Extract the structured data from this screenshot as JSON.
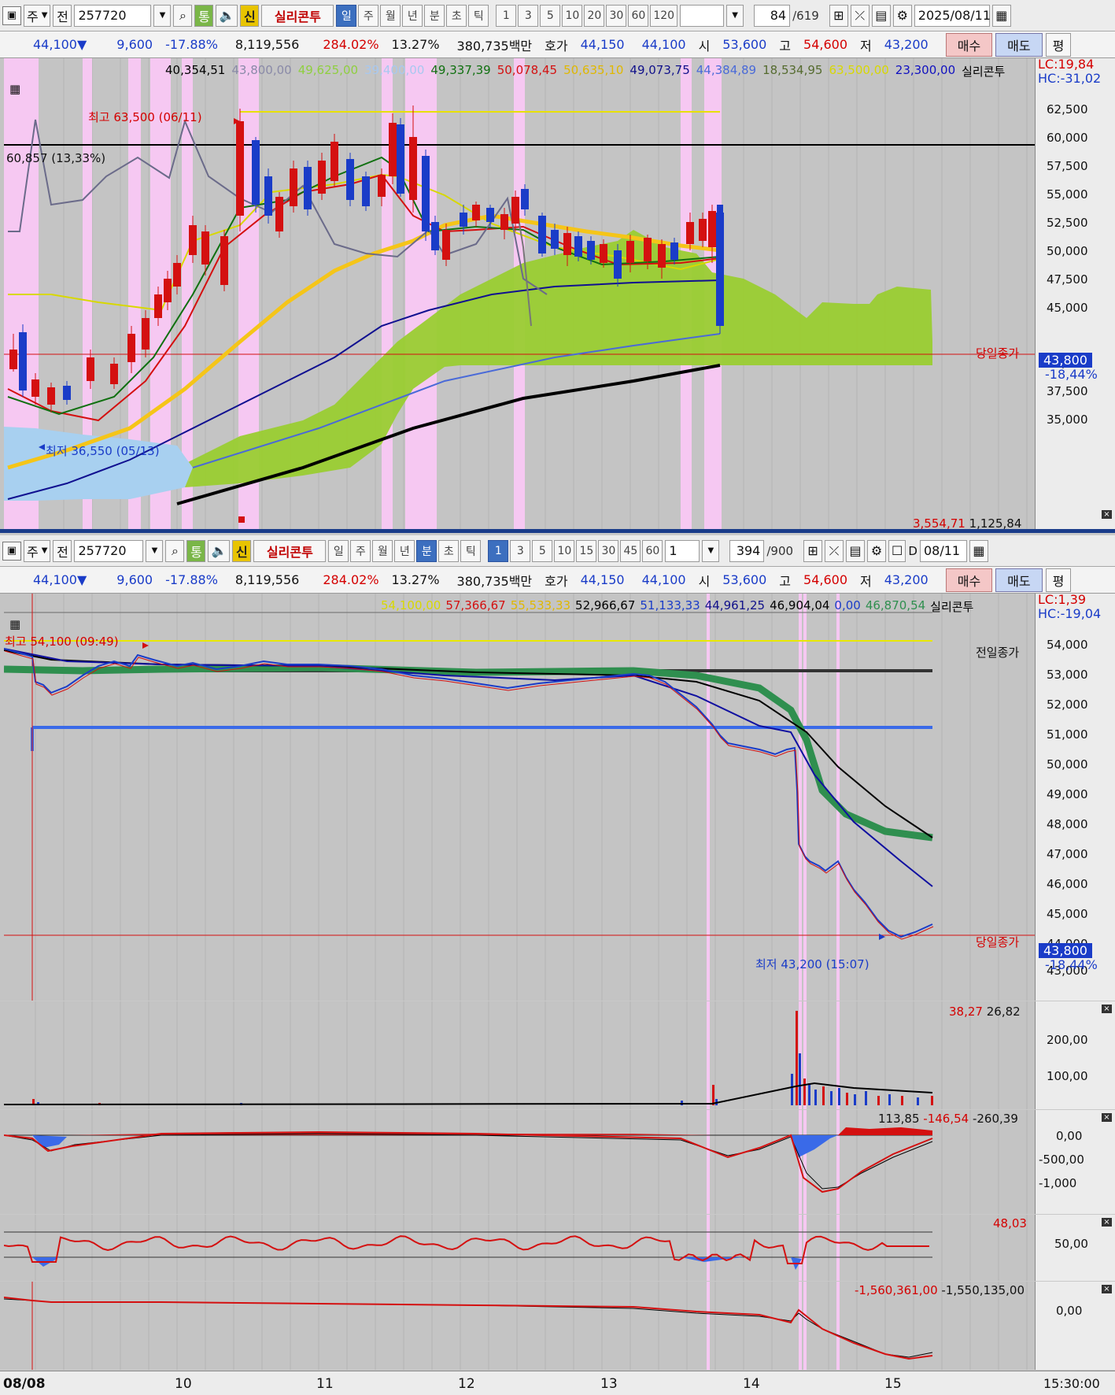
{
  "top_toolbar": {
    "type_btn": "주",
    "prev_btn": "전",
    "code": "257720",
    "tong": "통",
    "shin": "신",
    "name": "실리콘투",
    "periods": [
      "일",
      "주",
      "월",
      "년",
      "분",
      "초",
      "틱"
    ],
    "active_period": "일",
    "intervals": [
      "1",
      "3",
      "5",
      "10",
      "20",
      "30",
      "60",
      "120"
    ],
    "count": "84",
    "total": "/619",
    "date": "2025/08/11"
  },
  "bottom_toolbar": {
    "type_btn": "주",
    "prev_btn": "전",
    "code": "257720",
    "tong": "통",
    "shin": "신",
    "name": "실리콘투",
    "periods": [
      "일",
      "주",
      "월",
      "년",
      "분",
      "초",
      "틱"
    ],
    "active_period": "분",
    "intervals": [
      "1",
      "3",
      "5",
      "10",
      "15",
      "30",
      "45",
      "60"
    ],
    "active_interval": "1",
    "step": "1",
    "count": "394",
    "total": "/900",
    "d_label": "D",
    "date": "08/11"
  },
  "price_bar": {
    "price": "44,100▼",
    "change": "9,600",
    "rate": "-17.88%",
    "volume": "8,119,556",
    "vol_ratio": "284.02%",
    "turnover": "13.27%",
    "amount": "380,735백만",
    "hoga_label": "호가",
    "ask": "44,150",
    "bid": "44,100",
    "open_label": "시",
    "open": "53,600",
    "high_label": "고",
    "high": "54,600",
    "low_label": "저",
    "low": "43,200",
    "buy": "매수",
    "sell": "매도",
    "avg": "평"
  },
  "daily_chart": {
    "legend": [
      {
        "t": "40,354,51",
        "c": "#000000"
      },
      {
        "t": "43,800,00",
        "c": "#8a8aa8"
      },
      {
        "t": "49,625,00",
        "c": "#8fcf3f"
      },
      {
        "t": "39,400,00",
        "c": "#a8c8f0"
      },
      {
        "t": "49,337,39",
        "c": "#107010"
      },
      {
        "t": "50,078,45",
        "c": "#d41010"
      },
      {
        "t": "50,635,10",
        "c": "#e0b800"
      },
      {
        "t": "49,073,75",
        "c": "#10108a"
      },
      {
        "t": "44,384,89",
        "c": "#4a6ad8"
      },
      {
        "t": "18,534,95",
        "c": "#556b2f"
      },
      {
        "t": "63,500,00",
        "c": "#d8d800"
      },
      {
        "t": "23,300,00",
        "c": "#1010c0"
      },
      {
        "t": "실리콘투",
        "c": "#000000"
      }
    ],
    "lc": "LC:19,84",
    "hc": "HC:-31,02",
    "high_note": "최고 63,500 (06/11)",
    "low_note": "최저 36,550 (05/13)",
    "level_note": "60,857 (13,33%)",
    "prev_close_label": "당일종가",
    "current": "43,800",
    "current_pct": "-18,44%",
    "yticks": [
      "62,500",
      "60,000",
      "57,500",
      "55,000",
      "52,500",
      "50,000",
      "47,500",
      "45,000",
      "40,000",
      "37,500",
      "35,000"
    ],
    "bottom_values": {
      "a": "3,554,71",
      "b": "1,125,84"
    }
  },
  "intraday_chart": {
    "legend": [
      {
        "t": "54,100,00",
        "c": "#d8d800"
      },
      {
        "t": "57,366,67",
        "c": "#d41010"
      },
      {
        "t": "55,533,33",
        "c": "#e0b800"
      },
      {
        "t": "52,966,67",
        "c": "#000000"
      },
      {
        "t": "51,133,33",
        "c": "#1a3cc8"
      },
      {
        "t": "44,961,25",
        "c": "#10108a"
      },
      {
        "t": "46,904,04",
        "c": "#000000"
      },
      {
        "t": "0,00",
        "c": "#1a3cc8"
      },
      {
        "t": "46,870,54",
        "c": "#2f8f4f"
      },
      {
        "t": "실리콘투",
        "c": "#000000"
      }
    ],
    "lc": "LC:1,39",
    "hc": "HC:-19,04",
    "high_note": "최고 54,100 (09:49)",
    "low_note": "최저 43,200 (15:07)",
    "prev_close_label": "전일종가",
    "close_label": "당일종가",
    "current": "43,800",
    "current_pct": "-18,44%",
    "yticks": [
      "54,000",
      "53,000",
      "52,000",
      "51,000",
      "50,000",
      "49,000",
      "48,000",
      "47,000",
      "46,000",
      "45,000",
      "44,000",
      "43,000"
    ]
  },
  "volume_panel": {
    "v1": "38,27",
    "v2": "26,82",
    "yticks": [
      "200,00",
      "100,00"
    ]
  },
  "macd_panel": {
    "v1": "113,85",
    "v2": "-146,54",
    "v3": "-260,39",
    "yticks": [
      "0,00",
      "-500,00",
      "-1,000"
    ]
  },
  "rsi_panel": {
    "v1": "48,03",
    "yticks": [
      "50,00"
    ]
  },
  "obv_panel": {
    "v1": "-1,560,361,00",
    "v2": "-1,550,135,00",
    "yticks": [
      "0,00"
    ]
  },
  "x_axis": {
    "labels": [
      "08/08",
      "10",
      "11",
      "12",
      "13",
      "14",
      "15"
    ],
    "end": "15:30:00"
  }
}
